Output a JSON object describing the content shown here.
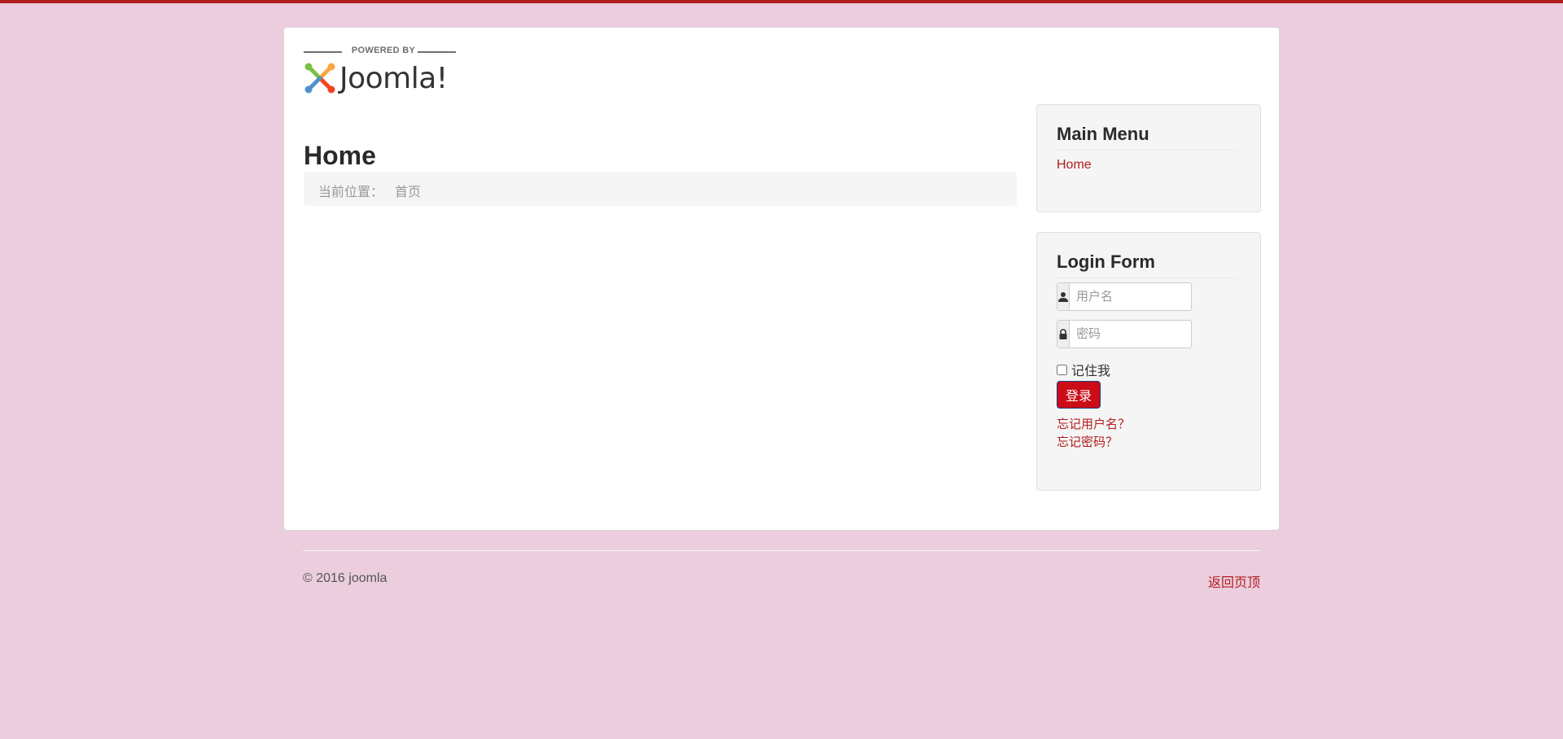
{
  "site": {
    "logo_top": "POWERED BY",
    "logo_name": "Joomla!",
    "logo_reg": "®"
  },
  "page": {
    "title": "Home",
    "breadcrumb": {
      "label": "当前位置：",
      "current": "首页"
    }
  },
  "main_menu": {
    "title": "Main Menu",
    "items": [
      {
        "label": "Home"
      }
    ]
  },
  "login_form": {
    "title": "Login Form",
    "username_placeholder": "用户名",
    "password_placeholder": "密码",
    "remember_label": "记住我",
    "submit_label": "登录",
    "forgot_username": "忘记用户名？",
    "forgot_password": "忘记密码？"
  },
  "footer": {
    "copyright": "© 2016 joomla",
    "back_to_top": "返回页顶"
  },
  "colors": {
    "background": "#ebcdde",
    "accent": "#b21d1d",
    "button": "#cc0c16"
  }
}
